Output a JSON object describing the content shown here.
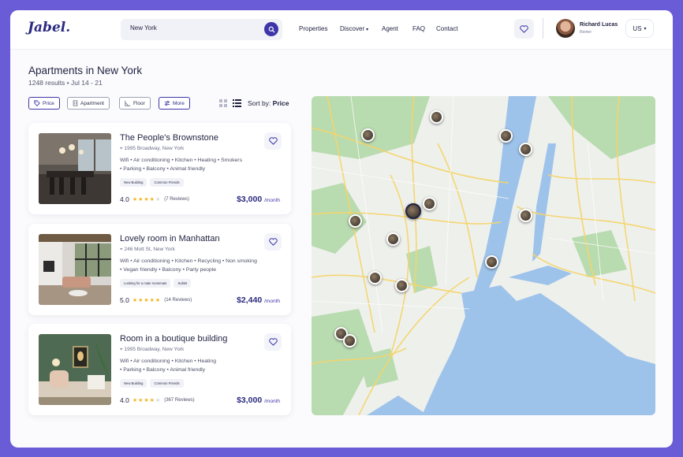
{
  "app": {
    "logo": "Jabel."
  },
  "search": {
    "value": "New York"
  },
  "nav": {
    "items": [
      {
        "label": "Properties"
      },
      {
        "label": "Discover",
        "dropdown": true
      },
      {
        "label": "Agent"
      },
      {
        "label": "FAQ"
      },
      {
        "label": "Contact"
      }
    ]
  },
  "user": {
    "name": "Richard Lucas",
    "role": "Renter"
  },
  "language": {
    "value": "US"
  },
  "page": {
    "title": "Apartments in New York",
    "subtitle": "1248 results • Jul 14 - 21"
  },
  "filters": [
    {
      "label": "Price",
      "icon": "tag-icon",
      "active": true
    },
    {
      "label": "Apartment",
      "icon": "building-icon",
      "active": false
    },
    {
      "label": "Floor",
      "icon": "floor-plan-icon",
      "active": false
    },
    {
      "label": "More",
      "icon": "sliders-icon",
      "active": true
    }
  ],
  "sort": {
    "prefix": "Sort by:",
    "value": "Price"
  },
  "listings": [
    {
      "title": "The People's Brownstone",
      "address": "1995 Broadway, New York",
      "amenities_line1": "Wifi • Air conditioning • Kitchen • Heating • Smokers",
      "amenities_line2": "• Parking • Balcony • Animal friendly",
      "tags": [
        "New Building",
        "Common Friends"
      ],
      "rating": "4.0",
      "rating_value": 4,
      "reviews": "(7 Reviews)",
      "price": "$3,000",
      "period": "/month"
    },
    {
      "title": "Lovely room in Manhattan",
      "address": "246 Mott St, New York",
      "amenities_line1": "Wifi • Air conditioning • Kitchen • Recycling  • Non smoking",
      "amenities_line2": "• Vegan friendly • Balcony • Party people",
      "tags": [
        "Looking for a male roommate",
        "Sublet"
      ],
      "rating": "5.0",
      "rating_value": 5,
      "reviews": "(14 Reviews)",
      "price": "$2,440",
      "period": "/month"
    },
    {
      "title": "Room in a boutique building",
      "address": "1995 Broadway, New York",
      "amenities_line1": "Wifi • Air conditioning • Kitchen • Heating",
      "amenities_line2": "• Parking • Balcony • Animal friendly",
      "tags": [
        "New Building",
        "Common Friends"
      ],
      "rating": "4.0",
      "rating_value": 4,
      "reviews": "(367 Reviews)",
      "price": "$3,000",
      "period": "/month"
    }
  ],
  "colors": {
    "accent": "#3f35a8",
    "brand": "#2b2a80",
    "star": "#f2b41f",
    "frame_bg": "#6a5bd6"
  }
}
